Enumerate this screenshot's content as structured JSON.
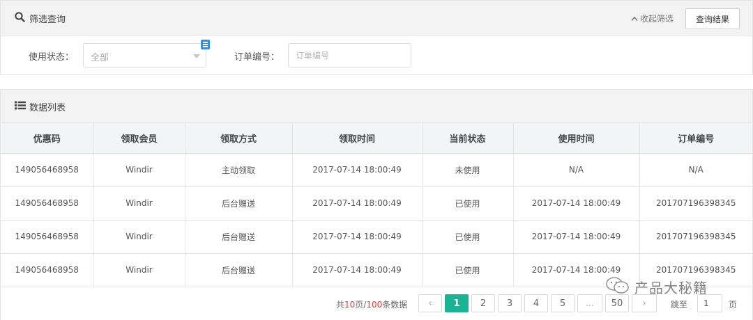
{
  "filter": {
    "title": "筛选查询",
    "collapse_label": "收起筛选",
    "query_button": "查询结果",
    "status_label": "使用状态：",
    "status_value": "全部",
    "order_label": "订单编号：",
    "order_placeholder": "订单编号"
  },
  "list": {
    "title": "数据列表",
    "columns": [
      "优惠码",
      "领取会员",
      "领取方式",
      "领取时间",
      "当前状态",
      "使用时间",
      "订单编号"
    ],
    "rows": [
      {
        "code": "149056468958",
        "member": "Windir",
        "method": "主动领取",
        "claim_time": "2017-07-14 18:00:49",
        "status": "未使用",
        "use_time": "N/A",
        "order_no": "N/A"
      },
      {
        "code": "149056468958",
        "member": "Windir",
        "method": "后台赠送",
        "claim_time": "2017-07-14 18:00:49",
        "status": "已使用",
        "use_time": "2017-07-14 18:00:49",
        "order_no": "201707196398345"
      },
      {
        "code": "149056468958",
        "member": "Windir",
        "method": "后台赠送",
        "claim_time": "2017-07-14 18:00:49",
        "status": "已使用",
        "use_time": "2017-07-14 18:00:49",
        "order_no": "201707196398345"
      },
      {
        "code": "149056468958",
        "member": "Windir",
        "method": "后台赠送",
        "claim_time": "2017-07-14 18:00:49",
        "status": "已使用",
        "use_time": "2017-07-14 18:00:49",
        "order_no": "201707196398345"
      }
    ]
  },
  "pagination": {
    "summary_prefix": "共",
    "total_pages": "10",
    "summary_mid": "页/",
    "total_records": "100",
    "summary_suffix": "条数据",
    "prev": "‹",
    "pages": [
      "1",
      "2",
      "3",
      "4",
      "5",
      "...",
      "50"
    ],
    "current_page": "1",
    "next": "›",
    "jump_label": "跳至",
    "jump_value": "1",
    "page_suffix": "页"
  },
  "watermark": {
    "text": "产品大秘籍"
  },
  "colors": {
    "accent": "#1ab394",
    "highlight": "#e4393c",
    "header_bg": "#f3f3f3",
    "badge": "#3b8fd9"
  }
}
